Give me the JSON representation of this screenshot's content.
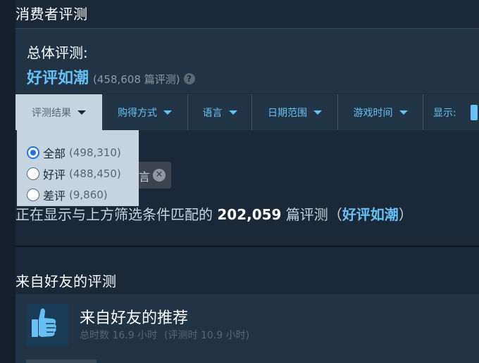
{
  "section_title": "消费者评测",
  "summary": {
    "label": "总体评测:",
    "rating": "好评如潮",
    "count": "(458,608 篇评测)",
    "help_glyph": "?",
    "help_icon": "question-mark-icon"
  },
  "filters": [
    {
      "label": "评测结果",
      "active": true
    },
    {
      "label": "购得方式"
    },
    {
      "label": "语言"
    },
    {
      "label": "日期范围"
    },
    {
      "label": "游戏时间"
    }
  ],
  "display_label": "显示:",
  "review_type_options": [
    {
      "label": "全部",
      "count": "(498,310)",
      "checked": true
    },
    {
      "label": "好评",
      "count": "(488,450)",
      "checked": false
    },
    {
      "label": "差评",
      "count": "(9,860)",
      "checked": false
    }
  ],
  "active_filter_tag": {
    "text": "言",
    "close_glyph": "✕"
  },
  "showing": {
    "prefix": "正在显示与上方筛选条件匹配的",
    "count": "202,059",
    "middle": "篇评测（",
    "rating": "好评如潮",
    "suffix": "）"
  },
  "friends_section_title": "来自好友的评测",
  "friend_review": {
    "title": "来自好友的推荐",
    "hours_total": "总时数 16.9 小时",
    "hours_at_review": "(评测时 10.9 小时)",
    "icon": "thumbs-up-icon"
  },
  "colors": {
    "page_bg": "#1b2838",
    "panel_bg": "#213446",
    "accent": "#66c0f4",
    "dropdown_bg": "#c6d4df",
    "muted_text": "#8f98a0"
  }
}
